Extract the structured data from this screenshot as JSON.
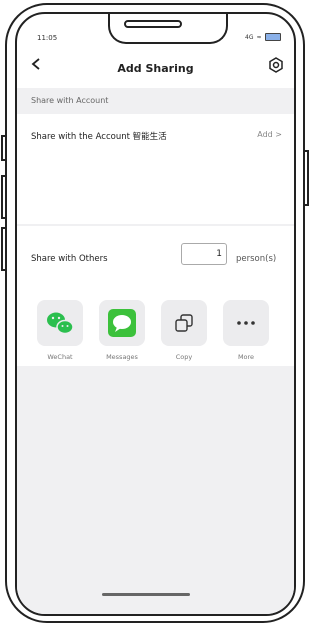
{
  "status_bar": {
    "time": "11:05",
    "network": "4G"
  },
  "header": {
    "title": "Add Sharing"
  },
  "share_account": {
    "section_label": "Share with Account",
    "row_label": "Share with the Account 智能生活",
    "add_label": "Add >"
  },
  "share_others": {
    "label": "Share with Others",
    "count_value": "1",
    "unit_label": "person(s)",
    "items": [
      {
        "label": "WeChat",
        "icon": "wechat-icon"
      },
      {
        "label": "Messages",
        "icon": "messages-icon"
      },
      {
        "label": "Copy",
        "icon": "copy-icon"
      },
      {
        "label": "More",
        "icon": "more-icon"
      }
    ]
  },
  "colors": {
    "wechat_green": "#2bbf4e",
    "messages_green": "#3cc13b",
    "section_bg": "#f0f0f2"
  }
}
